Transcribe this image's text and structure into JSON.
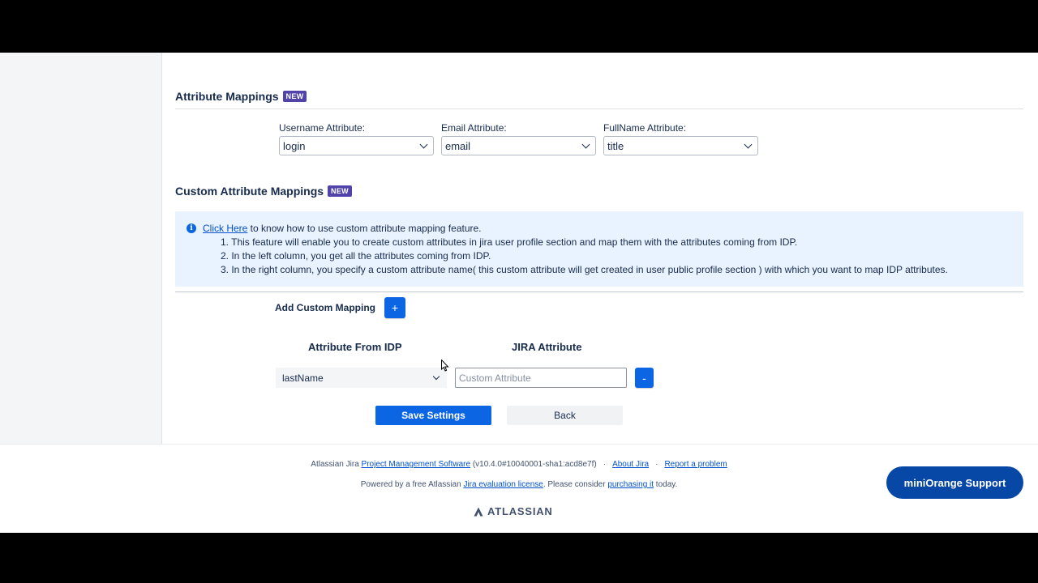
{
  "attribute_mappings": {
    "title": "Attribute Mappings",
    "badge": "NEW",
    "username": {
      "label": "Username Attribute:",
      "value": "login"
    },
    "email": {
      "label": "Email Attribute:",
      "value": "email"
    },
    "fullname": {
      "label": "FullName Attribute:",
      "value": "title"
    }
  },
  "custom_mappings": {
    "title": "Custom Attribute Mappings",
    "badge": "NEW",
    "info": {
      "icon": "info-icon",
      "link_text": "Click Here",
      "intro": " to know how to use custom attribute mapping feature.",
      "line1": "1. This feature will enable you to create custom attributes in jira user profile section and map them with the attributes coming from IDP.",
      "line2": "2. In the left column, you get all the attributes coming from IDP.",
      "line3": "3. In the right column, you specify a custom attribute name( this custom attribute will get created in user public profile section ) with which you want to map IDP attributes."
    },
    "add_label": "Add Custom Mapping",
    "add_button": "+",
    "col_idp": "Attribute From IDP",
    "col_jira": "JIRA Attribute",
    "idp_value": "lastName",
    "custom_placeholder": "Custom Attribute",
    "remove_button": "-"
  },
  "actions": {
    "save": "Save Settings",
    "back": "Back"
  },
  "footer": {
    "prefix": "Atlassian Jira ",
    "pm_link": "Project Management Software",
    "version": " (v10.4.0#10040001-sha1:acd8e7f)",
    "sep": "·",
    "about": "About Jira",
    "report": "Report a problem",
    "powered_prefix": "Powered by a free Atlassian ",
    "eval_link": "Jira evaluation license",
    "powered_mid": ". Please consider ",
    "purchase_link": "purchasing it",
    "powered_suffix": " today.",
    "logo_text": "ATLASSIAN"
  },
  "support_button": "miniOrange Support"
}
